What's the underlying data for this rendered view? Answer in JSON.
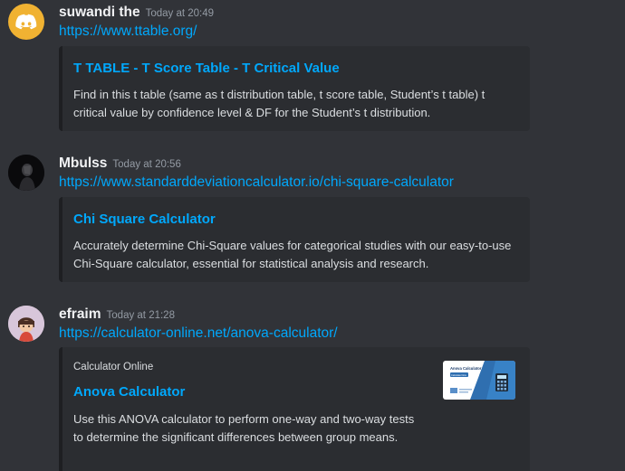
{
  "messages": [
    {
      "username": "suwandi the",
      "timestamp": "Today at 20:49",
      "avatar_icon": "discord-logo-icon",
      "avatar_color": "#f0b232",
      "link": "https://www.ttable.org/",
      "embed": {
        "title": "T TABLE - T Score Table - T Critical Value",
        "description": "Find in this t table (same as t distribution table, t score table, Student’s t table) t critical value by confidence level & DF for the Student’s t distribution."
      }
    },
    {
      "username": "Mbulss",
      "timestamp": "Today at 20:56",
      "avatar_icon": "dark-profile-photo-icon",
      "link": "https://www.standarddeviationcalculator.io/chi-square-calculator",
      "embed": {
        "title": "Chi Square Calculator",
        "description": "Accurately determine Chi-Square values for categorical studies with our easy-to-use Chi-Square calculator, essential for statistical analysis and research."
      }
    },
    {
      "username": "efraim",
      "timestamp": "Today at 21:28",
      "avatar_icon": "cartoon-character-icon",
      "link": "https://calculator-online.net/anova-calculator/",
      "embed": {
        "provider": "Calculator Online",
        "title": "Anova Calculator",
        "description": "Use this ANOVA calculator to perform one-way and two-way tests to determine the significant differences between group means.",
        "thumbnail_icon": "anova-calculator-thumbnail-icon",
        "thumbnail_title": "Anova Calculator",
        "thumbnail_button": "Calculate Now"
      }
    }
  ],
  "colors": {
    "background": "#313338",
    "embed_background": "#2b2d31",
    "link": "#00a8fc",
    "username": "#f2f3f5",
    "timestamp": "#949ba4",
    "text": "#dbdee1"
  }
}
